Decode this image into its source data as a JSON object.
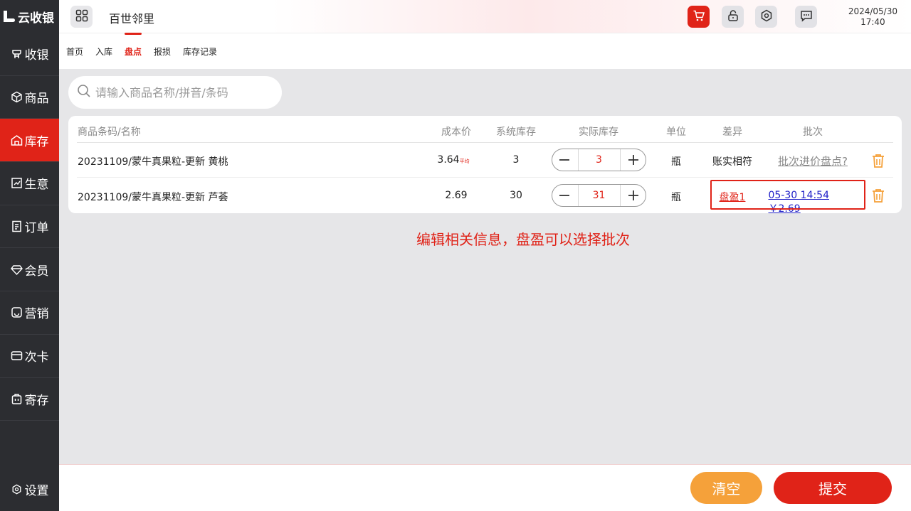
{
  "app": {
    "logo_text": "云收银"
  },
  "sidebar": {
    "items": [
      {
        "label": "收银",
        "icon": "cashier-icon",
        "active": false
      },
      {
        "label": "商品",
        "icon": "box-icon",
        "active": false
      },
      {
        "label": "库存",
        "icon": "warehouse-icon",
        "active": true
      },
      {
        "label": "生意",
        "icon": "report-icon",
        "active": false
      },
      {
        "label": "订单",
        "icon": "order-icon",
        "active": false
      },
      {
        "label": "会员",
        "icon": "diamond-icon",
        "active": false
      },
      {
        "label": "营销",
        "icon": "marketing-icon",
        "active": false
      },
      {
        "label": "次卡",
        "icon": "card-icon",
        "active": false
      },
      {
        "label": "寄存",
        "icon": "locker-icon",
        "active": false
      }
    ],
    "settings_label": "设置"
  },
  "header": {
    "store_name": "百世邻里",
    "date": "2024/05/30",
    "time": "17:40",
    "buttons": [
      "cart-icon",
      "lock-icon",
      "settings-hex-icon",
      "message-icon"
    ]
  },
  "tabs": [
    {
      "label": "首页",
      "active": false
    },
    {
      "label": "入库",
      "active": false
    },
    {
      "label": "盘点",
      "active": true
    },
    {
      "label": "报损",
      "active": false
    },
    {
      "label": "库存记录",
      "active": false
    }
  ],
  "search": {
    "placeholder": "请输入商品名称/拼音/条码",
    "value": ""
  },
  "table": {
    "columns": [
      "商品条码/名称",
      "成本价",
      "系统库存",
      "实际库存",
      "单位",
      "差异",
      "批次"
    ],
    "rows": [
      {
        "name": "20231109/蒙牛真果粒-更新 黄桃",
        "cost": "3.64",
        "cost_tag": "平均",
        "system_stock": "3",
        "actual_stock": "3",
        "unit": "瓶",
        "diff": "账实相符",
        "batch": "批次进价盘点?"
      },
      {
        "name": "20231109/蒙牛真果粒-更新 芦荟",
        "cost": "2.69",
        "cost_tag": "",
        "system_stock": "30",
        "actual_stock": "31",
        "unit": "瓶",
        "diff": "盘盈1",
        "batch": "05-30 14:54 ￥2.69"
      }
    ]
  },
  "annotation": "编辑相关信息，盘盈可以选择批次",
  "footer": {
    "clear_label": "清空",
    "submit_label": "提交"
  },
  "colors": {
    "accent": "#e02318",
    "sidebar": "#2c2d31",
    "clear_button": "#f5a13a",
    "batch_link": "#1f1fc8"
  }
}
